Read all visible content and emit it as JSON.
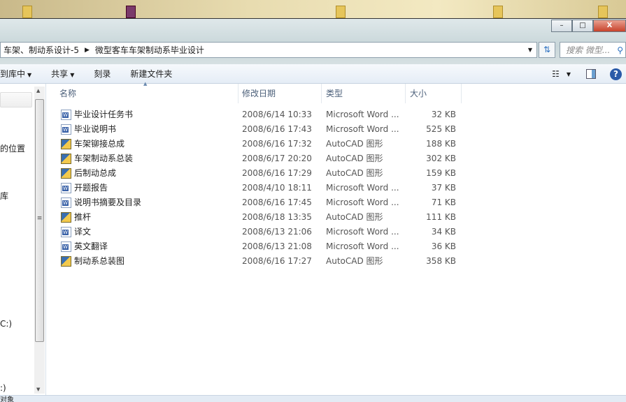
{
  "address": {
    "crumbs": [
      "车架、制动系设计-5",
      "微型客车车架制动系毕业设计"
    ]
  },
  "search": {
    "placeholder": "搜索 微型..."
  },
  "window": {
    "minimize": "–",
    "maximize": "□",
    "close": "X"
  },
  "toolbar": {
    "include_library": "到库中",
    "share": "共享",
    "burn": "刻录",
    "new_folder": "新建文件夹"
  },
  "nav": {
    "items": [
      "的位置",
      "库",
      "C:)",
      ":)"
    ]
  },
  "columns": {
    "name": "名称",
    "date": "修改日期",
    "type": "类型",
    "size": "大小"
  },
  "files": [
    {
      "name": "毕业设计任务书",
      "date": "2008/6/14 10:33",
      "type": "Microsoft Word ...",
      "size": "32 KB",
      "icon": "word"
    },
    {
      "name": "毕业说明书",
      "date": "2008/6/16 17:43",
      "type": "Microsoft Word ...",
      "size": "525 KB",
      "icon": "word"
    },
    {
      "name": "车架铆接总成",
      "date": "2008/6/16 17:32",
      "type": "AutoCAD 图形",
      "size": "188 KB",
      "icon": "cad"
    },
    {
      "name": "车架制动系总装",
      "date": "2008/6/17 20:20",
      "type": "AutoCAD 图形",
      "size": "302 KB",
      "icon": "cad"
    },
    {
      "name": "后制动总成",
      "date": "2008/6/16 17:29",
      "type": "AutoCAD 图形",
      "size": "159 KB",
      "icon": "cad"
    },
    {
      "name": "开题报告",
      "date": "2008/4/10 18:11",
      "type": "Microsoft Word ...",
      "size": "37 KB",
      "icon": "word"
    },
    {
      "name": "说明书摘要及目录",
      "date": "2008/6/16 17:45",
      "type": "Microsoft Word ...",
      "size": "71 KB",
      "icon": "word"
    },
    {
      "name": "推杆",
      "date": "2008/6/18 13:35",
      "type": "AutoCAD 图形",
      "size": "111 KB",
      "icon": "cad"
    },
    {
      "name": "译文",
      "date": "2008/6/13 21:06",
      "type": "Microsoft Word ...",
      "size": "34 KB",
      "icon": "word"
    },
    {
      "name": "英文翻译",
      "date": "2008/6/13 21:08",
      "type": "Microsoft Word ...",
      "size": "36 KB",
      "icon": "word"
    },
    {
      "name": "制动系总装图",
      "date": "2008/6/16 17:27",
      "type": "AutoCAD 图形",
      "size": "358 KB",
      "icon": "cad"
    }
  ],
  "status": {
    "text": "对象"
  }
}
